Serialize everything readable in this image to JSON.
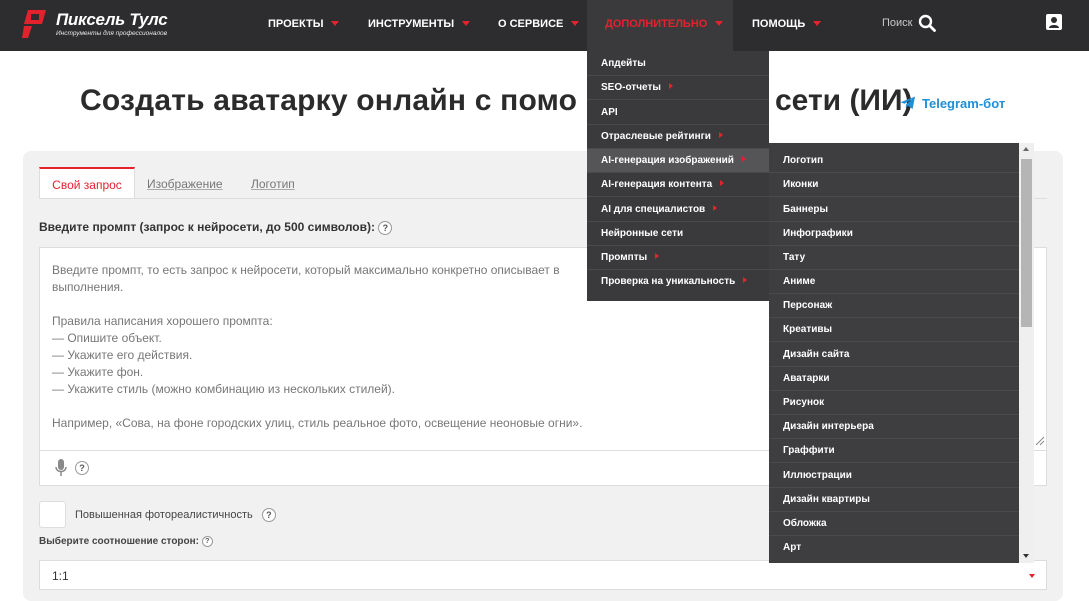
{
  "header": {
    "logo_title": "Пиксель Тулс",
    "logo_subtitle": "Инструменты для профессионалов",
    "nav": [
      {
        "label": "ПРОЕКТЫ"
      },
      {
        "label": "ИНСТРУМЕНТЫ"
      },
      {
        "label": "О СЕРВИСЕ"
      },
      {
        "label": "ДОПОЛНИТЕЛЬНО"
      },
      {
        "label": "ПОМОЩЬ"
      }
    ],
    "search_label": "Поиск"
  },
  "page": {
    "title": "Создать аватарку онлайн с помо",
    "title_tail": "сети (ИИ)",
    "telegram_label": "Telegram-бот"
  },
  "tabs": [
    {
      "label": "Свой запрос"
    },
    {
      "label": "Изображение"
    },
    {
      "label": "Логотип"
    }
  ],
  "form": {
    "prompt_label": "Введите промпт (запрос к нейросети, до 500 символов):",
    "help": "?",
    "placeholder": "Введите промпт, то есть запрос к нейросети, который максимально конкретно описывает в\nвыполнения.\n\nПравила написания хорошего промпта:\n— Опишите объект.\n— Укажите его действия.\n— Укажите фон.\n— Укажите стиль (можно комбинацию из нескольких стилей).\n\nНапример, «Сова, на фоне городских улиц, стиль реальное фото, освещение неоновые огни».",
    "photorealism_label": "Повышенная фотореалистичность",
    "ratio_label": "Выберите соотношение сторон:",
    "ratio_value": "1:1"
  },
  "dropdown_main": [
    {
      "label": "Апдейты"
    },
    {
      "label": "SEO-отчеты"
    },
    {
      "label": "API"
    },
    {
      "label": "Отраслевые рейтинги"
    },
    {
      "label": "AI-генерация изображений"
    },
    {
      "label": "AI-генерация контента"
    },
    {
      "label": "AI для специалистов"
    },
    {
      "label": "Нейронные сети"
    },
    {
      "label": "Промпты"
    },
    {
      "label": "Проверка на уникальность"
    }
  ],
  "dropdown_sub": [
    {
      "label": "Логотип"
    },
    {
      "label": "Иконки"
    },
    {
      "label": "Баннеры"
    },
    {
      "label": "Инфографики"
    },
    {
      "label": "Тату"
    },
    {
      "label": "Аниме"
    },
    {
      "label": "Персонаж"
    },
    {
      "label": "Креативы"
    },
    {
      "label": "Дизайн сайта"
    },
    {
      "label": "Аватарки"
    },
    {
      "label": "Рисунок"
    },
    {
      "label": "Дизайн интерьера"
    },
    {
      "label": "Граффити"
    },
    {
      "label": "Иллюстрации"
    },
    {
      "label": "Дизайн квартиры"
    },
    {
      "label": "Обложка"
    },
    {
      "label": "Арт"
    }
  ],
  "colors": {
    "accent": "#e4222e",
    "header_bg": "#2d2d2f",
    "telegram": "#1f8fd6"
  }
}
